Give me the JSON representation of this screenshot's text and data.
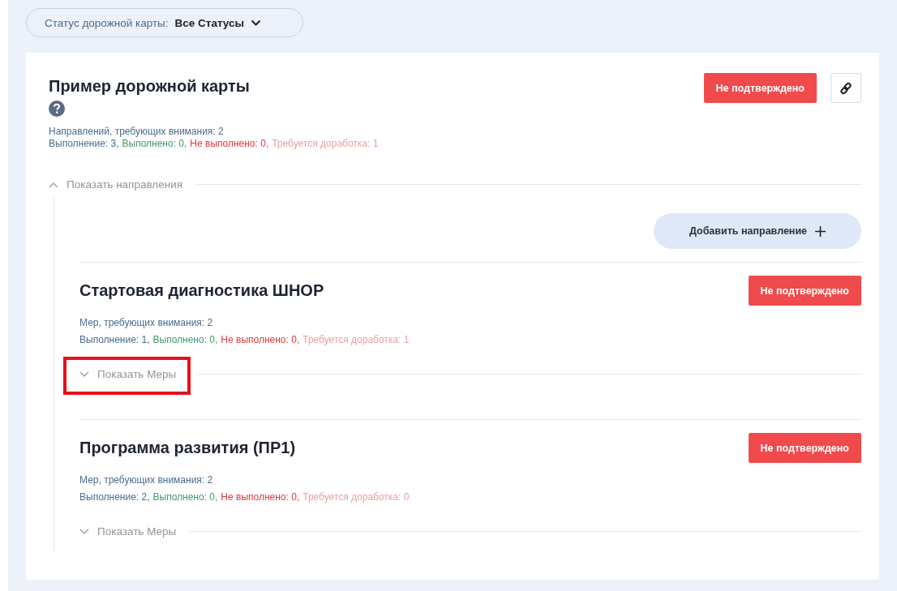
{
  "filter": {
    "label": "Статус дорожной карты:",
    "value": "Все Статусы"
  },
  "roadmap": {
    "title": "Пример дорожной карты",
    "status": "Не подтверждено",
    "summary": "Направлений, требующих внимания: 2",
    "stats": [
      {
        "kind": "progress",
        "text": "Выполнение: 3,"
      },
      {
        "kind": "done",
        "text": "Выполнено: 0,"
      },
      {
        "kind": "failed",
        "text": "Не выполнено: 0,"
      },
      {
        "kind": "rework",
        "text": "Требуется доработка: 1"
      }
    ],
    "toggle": {
      "label": "Показать направления",
      "expanded": true,
      "highlighted": false
    },
    "add_button": "Добавить направление",
    "directions": [
      {
        "title": "Стартовая диагностика ШНОР",
        "status": "Не подтверждено",
        "summary": "Мер, требующих внимания: 2",
        "stats": [
          {
            "kind": "progress",
            "text": "Выполнение: 1,"
          },
          {
            "kind": "done",
            "text": "Выполнено: 0,"
          },
          {
            "kind": "failed",
            "text": "Не выполнено: 0,"
          },
          {
            "kind": "rework",
            "text": "Требуется доработка: 1"
          }
        ],
        "toggle": {
          "label": "Показать Меры",
          "expanded": false,
          "highlighted": true
        }
      },
      {
        "title": "Программа развития (ПР1)",
        "status": "Не подтверждено",
        "summary": "Мер, требующих внимания: 2",
        "stats": [
          {
            "kind": "progress",
            "text": "Выполнение: 2,"
          },
          {
            "kind": "done",
            "text": "Выполнено: 0,"
          },
          {
            "kind": "failed",
            "text": "Не выполнено: 0,"
          },
          {
            "kind": "rework",
            "text": "Требуется доработка: 0"
          }
        ],
        "toggle": {
          "label": "Показать Меры",
          "expanded": false,
          "highlighted": false
        }
      }
    ]
  }
}
